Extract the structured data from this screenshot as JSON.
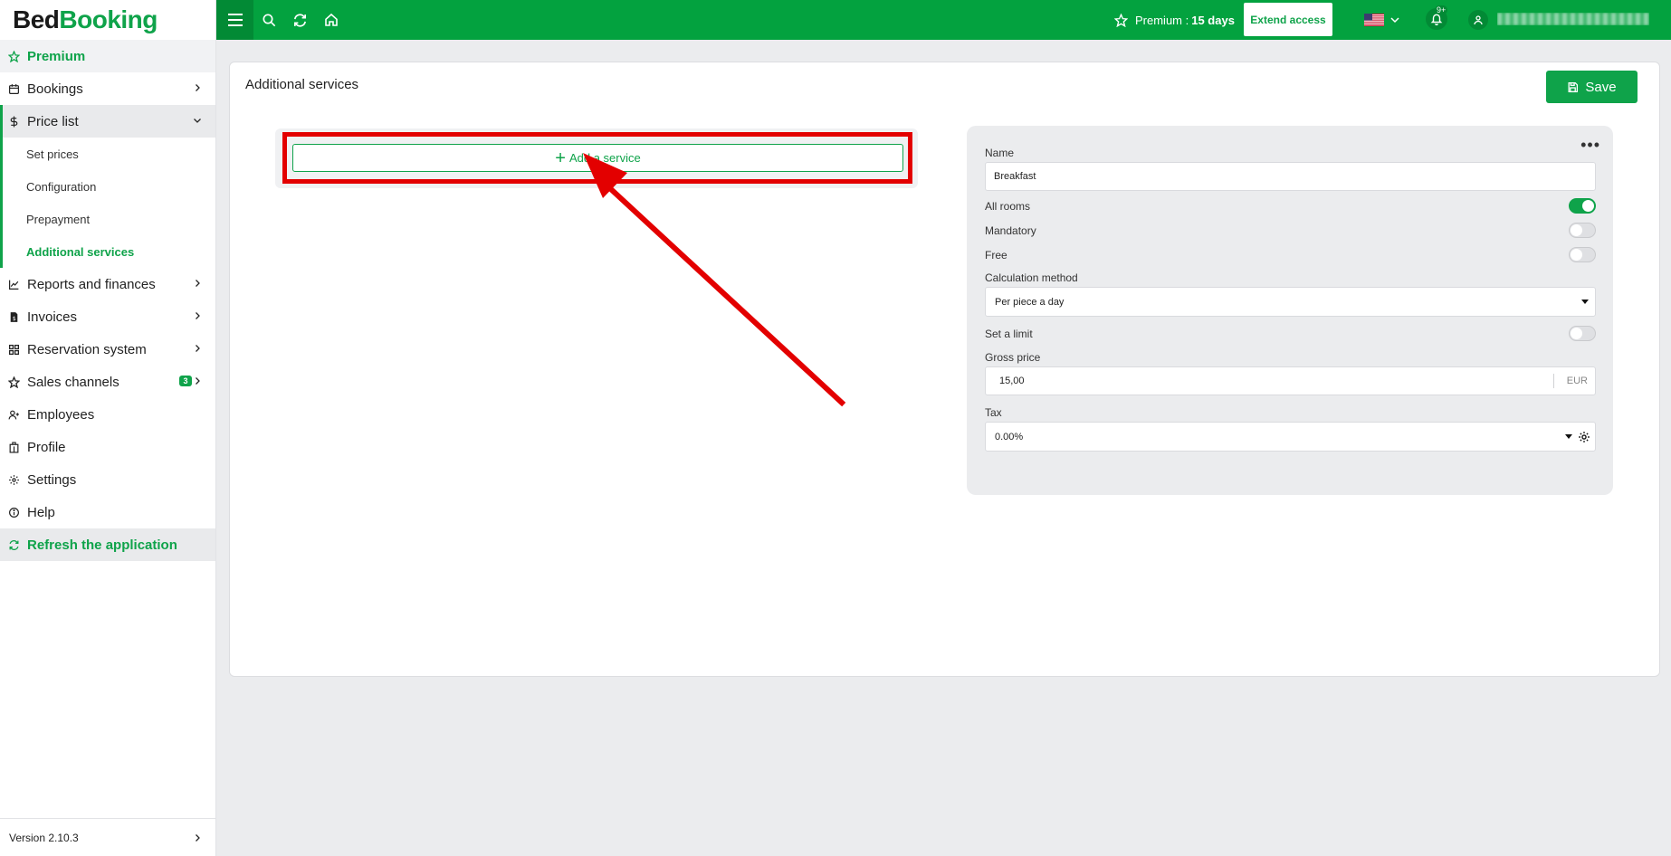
{
  "app": {
    "brand_part1": "Bed",
    "brand_part2": "Booking",
    "brand_color": "#0fa34a"
  },
  "sidebar": {
    "premium": "Premium",
    "items": [
      {
        "label": "Bookings",
        "icon": "calendar-icon"
      },
      {
        "label": "Price list",
        "icon": "dollar-icon"
      },
      {
        "label": "Reports and finances",
        "icon": "chart-icon"
      },
      {
        "label": "Invoices",
        "icon": "invoice-icon"
      },
      {
        "label": "Reservation system",
        "icon": "grid-icon"
      },
      {
        "label": "Sales channels",
        "icon": "star-icon",
        "badge": "3"
      },
      {
        "label": "Employees",
        "icon": "user-plus-icon"
      },
      {
        "label": "Profile",
        "icon": "building-icon"
      },
      {
        "label": "Settings",
        "icon": "gear-icon"
      },
      {
        "label": "Help",
        "icon": "info-icon"
      }
    ],
    "sub_items": [
      "Set prices",
      "Configuration",
      "Prepayment",
      "Additional services"
    ],
    "refresh": "Refresh the application",
    "version": "Version 2.10.3"
  },
  "topbar": {
    "premium_label": "Premium :",
    "premium_days": "15 days",
    "extend_access": "Extend access",
    "notifications_badge": "9+"
  },
  "page": {
    "title": "Additional services",
    "save_label": "Save",
    "add_service_label": "Add a service"
  },
  "form": {
    "name_label": "Name",
    "name_value": "Breakfast",
    "all_rooms_label": "All rooms",
    "all_rooms_on": true,
    "mandatory_label": "Mandatory",
    "mandatory_on": false,
    "free_label": "Free",
    "free_on": false,
    "calc_method_label": "Calculation method",
    "calc_method_value": "Per piece a day",
    "limit_label": "Set a limit",
    "limit_on": false,
    "gross_price_label": "Gross price",
    "gross_price_value": "15,00",
    "currency": "EUR",
    "tax_label": "Tax",
    "tax_value": "0.00%"
  }
}
